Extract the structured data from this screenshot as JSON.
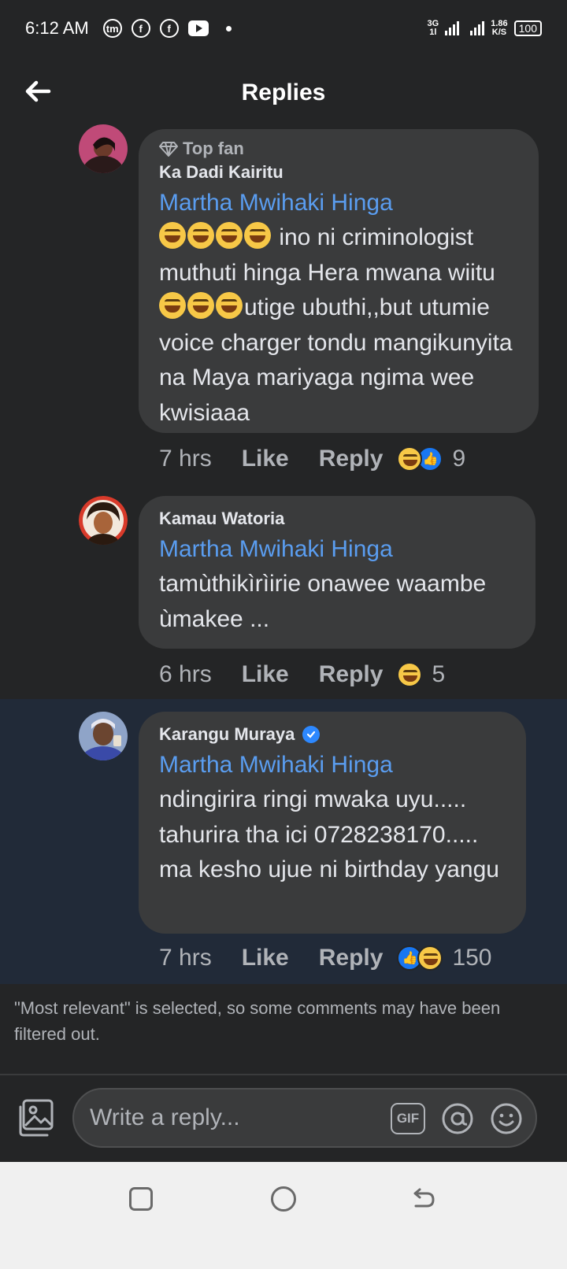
{
  "status_bar": {
    "time": "6:12 AM",
    "net_type_top": "3G",
    "net_type_bottom": "1l",
    "speed_value": "1.86",
    "speed_unit": "K/S",
    "battery": "100"
  },
  "header": {
    "title": "Replies"
  },
  "comments": [
    {
      "badge": "Top fan",
      "author": "Ka Dadi Kairitu",
      "mention": "Martha Mwihaki Hinga",
      "text_part1": " ino ni criminologist muthuti hinga Hera mwana wiitu ",
      "text_part2": "utige ubuthi,,but utumie voice charger tondu mangikunyita na Maya mariyaga ngima wee kwisiaaa",
      "time": "7 hrs",
      "like_label": "Like",
      "reply_label": "Reply",
      "reaction_count": "9"
    },
    {
      "author": "Kamau Watoria",
      "mention": "Martha Mwihaki Hinga",
      "text": "tamùthikìrìirie onawee waambe ùmakee ...",
      "time": "6 hrs",
      "like_label": "Like",
      "reply_label": "Reply",
      "reaction_count": "5"
    },
    {
      "author": "Karangu Muraya",
      "verified": true,
      "mention": "Martha Mwihaki Hinga",
      "text": "ndingirira ringi mwaka uyu..... tahurira tha ici 0728238170..... ma kesho ujue ni birthday yangu",
      "time": "7 hrs",
      "like_label": "Like",
      "reply_label": "Reply",
      "reaction_count": "150"
    }
  ],
  "filter_notice": "\"Most relevant\" is selected, so some comments may have been filtered out.",
  "composer": {
    "placeholder": "Write a reply...",
    "gif_label": "GIF"
  },
  "icons": [
    "back-arrow-icon",
    "photo-icon",
    "gif-icon",
    "at-icon",
    "emoji-icon",
    "diamond-icon",
    "verified-icon"
  ],
  "colors": {
    "background": "#242526",
    "bubble": "#3a3b3c",
    "mention": "#5a9df0",
    "highlight": "#212a38",
    "like_blue": "#1877f2"
  }
}
